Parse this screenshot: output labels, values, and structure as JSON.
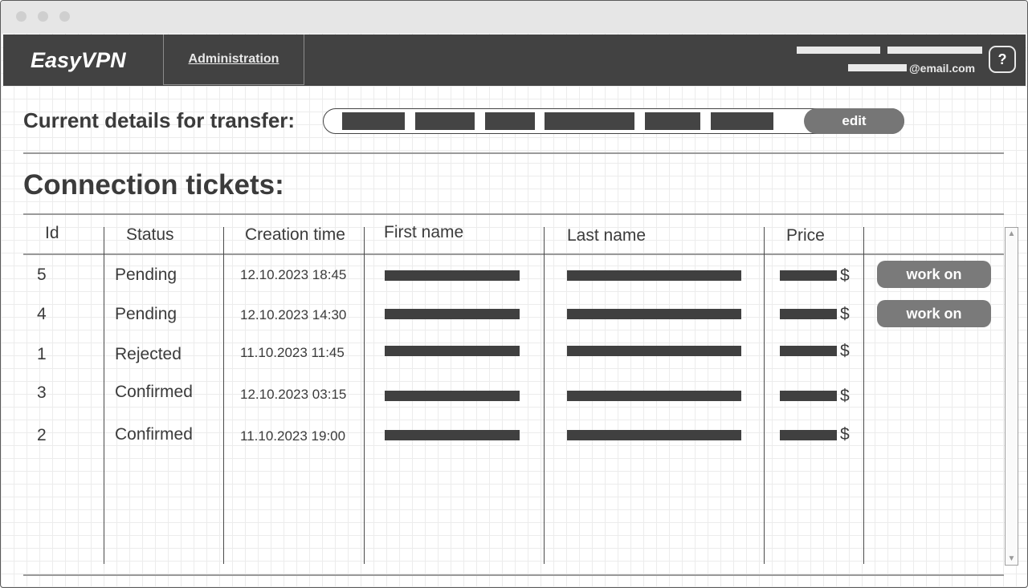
{
  "app": {
    "brand": "EasyVPN"
  },
  "nav": {
    "admin_tab": "Administration",
    "email_suffix": "@email.com",
    "help_label": "?"
  },
  "transfer": {
    "label": "Current details for transfer:",
    "edit_label": "edit"
  },
  "tickets": {
    "title": "Connection tickets:",
    "columns": {
      "id": "Id",
      "status": "Status",
      "created": "Creation time",
      "first": "First name",
      "last": "Last name",
      "price": "Price"
    },
    "currency": "$",
    "work_on_label": "work on",
    "rows": [
      {
        "id": "5",
        "status": "Pending",
        "created": "12.10.2023 18:45",
        "action": true
      },
      {
        "id": "4",
        "status": "Pending",
        "created": "12.10.2023 14:30",
        "action": true
      },
      {
        "id": "1",
        "status": "Rejected",
        "created": "11.10.2023 11:45",
        "action": false
      },
      {
        "id": "3",
        "status": "Confirmed",
        "created": "12.10.2023 03:15",
        "action": false
      },
      {
        "id": "2",
        "status": "Confirmed",
        "created": "11.10.2023 19:00",
        "action": false
      }
    ]
  },
  "icons": {
    "help": "question-mark-icon",
    "scroll_up": "scroll-up-arrow-icon",
    "scroll_down": "scroll-down-arrow-icon"
  }
}
